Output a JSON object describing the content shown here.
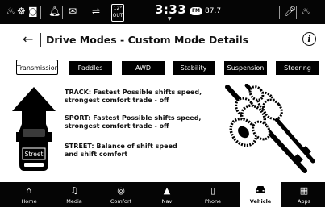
{
  "status_bar": {
    "icons": [
      "seat-heat-icon",
      "steering-heat-icon",
      "camera-icon",
      "notification-bell-icon",
      "sms-message-icon",
      "usb-icon",
      "microphone-icon",
      "wheel-heat-icon"
    ],
    "temperature": "12°",
    "temperature_unit": "OUT",
    "time": "3:33",
    "radio_badge": "FM",
    "radio_frequency": "87.7"
  },
  "header": {
    "title": "Drive Modes - Custom Mode Details"
  },
  "tabs": [
    {
      "label": "Transmission",
      "active": true
    },
    {
      "label": "Paddles",
      "active": false
    },
    {
      "label": "AWD",
      "active": false
    },
    {
      "label": "Stability",
      "active": false
    },
    {
      "label": "Suspension",
      "active": false
    },
    {
      "label": "Steering",
      "active": false
    }
  ],
  "content": {
    "selected_mode": "Street",
    "descriptions": [
      {
        "line1": "TRACK: Fastest Possible shifts speed,",
        "line2": "strongest comfort trade - off"
      },
      {
        "line1": "SPORT: Fastest Possible shifts speed,",
        "line2": "strongest comfort trade - off"
      },
      {
        "line1": "STREET: Balance of shift speed",
        "line2": "and shift comfort"
      }
    ]
  },
  "nav": [
    {
      "label": "Home",
      "icon": "home-icon",
      "active": false
    },
    {
      "label": "Media",
      "icon": "music-note-icon",
      "active": false
    },
    {
      "label": "Comfort",
      "icon": "climate-icon",
      "active": false
    },
    {
      "label": "Nav",
      "icon": "navigation-arrow-icon",
      "active": false
    },
    {
      "label": "Phone",
      "icon": "phone-icon",
      "active": false
    },
    {
      "label": "Vehicle",
      "icon": "car-icon",
      "active": true
    },
    {
      "label": "Apps",
      "icon": "apps-grid-icon",
      "active": false
    }
  ],
  "colors": {
    "bar_background": "#050505",
    "tab_inactive": "#000000",
    "tab_active_background": "#ffffff",
    "page_background": "#ffffff"
  }
}
